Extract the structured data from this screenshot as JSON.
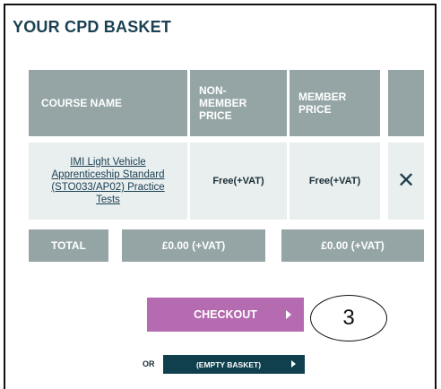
{
  "basket": {
    "title": "YOUR CPD BASKET"
  },
  "table": {
    "headers": {
      "course_name": "COURSE NAME",
      "non_member_price": [
        "NON-",
        "MEMBER",
        "PRICE"
      ],
      "member_price": [
        "MEMBER",
        "PRICE"
      ]
    },
    "rows": [
      {
        "course_name": "IMI Light Vehicle Apprenticeship Standard (STO033/AP02) Practice Tests",
        "non_member_price": "Free(+VAT)",
        "member_price": "Free(+VAT)",
        "remove_icon": "close-x-icon"
      }
    ],
    "total": {
      "label": "TOTAL",
      "non_member_total": "£0.00 (+VAT)",
      "member_total": "£0.00 (+VAT)"
    }
  },
  "actions": {
    "checkout_label": "CHECKOUT",
    "or_label": "OR",
    "empty_basket_label": "(EMPTY BASKET)"
  },
  "annotation": {
    "step_number": "3"
  },
  "colors": {
    "header_gray": "#95a5a6",
    "row_bg": "#e9eeef",
    "title_navy": "#1b4152",
    "checkout_purple": "#b56bb0",
    "empty_basket_dark": "#10404e"
  }
}
